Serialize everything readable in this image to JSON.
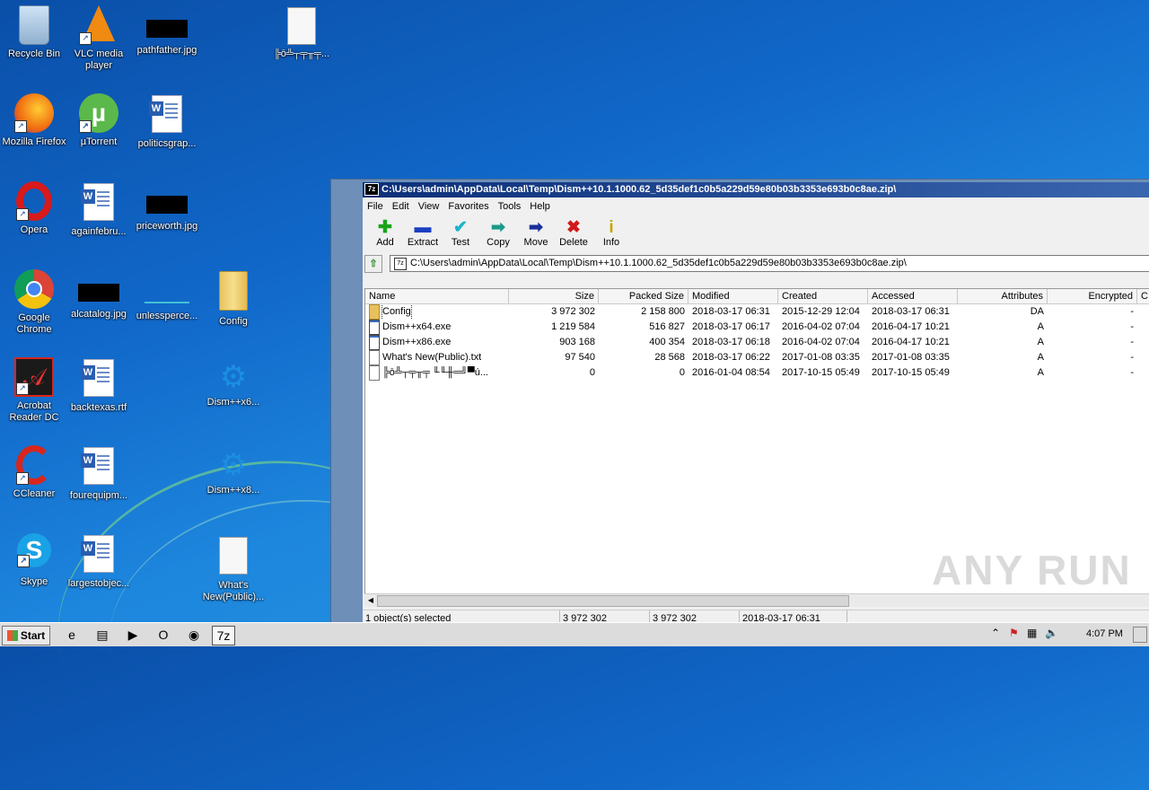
{
  "desktop": {
    "icons": [
      {
        "label": "Recycle Bin"
      },
      {
        "label": "VLC media player"
      },
      {
        "label": "pathfather.jpg"
      },
      {
        "label": "╠ō╩┬╤╥╤..."
      },
      {
        "label": "Mozilla Firefox"
      },
      {
        "label": "µTorrent"
      },
      {
        "label": "politicsgrap..."
      },
      {
        "label": "Opera"
      },
      {
        "label": "againfebru..."
      },
      {
        "label": "priceworth.jpg"
      },
      {
        "label": "Google Chrome"
      },
      {
        "label": "alcatalog.jpg"
      },
      {
        "label": "unlessperce..."
      },
      {
        "label": "Config"
      },
      {
        "label": "Acrobat Reader DC"
      },
      {
        "label": "backtexas.rtf"
      },
      {
        "label": "Dism++x6..."
      },
      {
        "label": "CCleaner"
      },
      {
        "label": "fourequipm..."
      },
      {
        "label": "Dism++x8..."
      },
      {
        "label": "Skype"
      },
      {
        "label": "largestobjec..."
      },
      {
        "label": "What's New(Public)..."
      }
    ]
  },
  "window": {
    "title": "C:\\Users\\admin\\AppData\\Local\\Temp\\Dism++10.1.1000.62_5d35def1c0b5a229d59e80b03b3353e693b0c8ae.zip\\",
    "title_icon": "7z",
    "menu": [
      "File",
      "Edit",
      "View",
      "Favorites",
      "Tools",
      "Help"
    ],
    "toolbar": [
      {
        "label": "Add",
        "icon": "plus-icon",
        "glyph": "✚",
        "color": "#1aa31a"
      },
      {
        "label": "Extract",
        "icon": "minus-icon",
        "glyph": "▬",
        "color": "#1b3fc2"
      },
      {
        "label": "Test",
        "icon": "check-icon",
        "glyph": "✔",
        "color": "#1bb5c8"
      },
      {
        "label": "Copy",
        "icon": "copy-arrow-icon",
        "glyph": "➡",
        "color": "#1a9a8a"
      },
      {
        "label": "Move",
        "icon": "move-arrow-icon",
        "glyph": "➡",
        "color": "#1a2f9a"
      },
      {
        "label": "Delete",
        "icon": "delete-x-icon",
        "glyph": "✖",
        "color": "#d01a1a"
      },
      {
        "label": "Info",
        "icon": "info-icon",
        "glyph": "i",
        "color": "#c8a400"
      }
    ],
    "address": "C:\\Users\\admin\\AppData\\Local\\Temp\\Dism++10.1.1000.62_5d35def1c0b5a229d59e80b03b3353e693b0c8ae.zip\\",
    "columns": [
      "Name",
      "Size",
      "Packed Size",
      "Modified",
      "Created",
      "Accessed",
      "Attributes",
      "Encrypted",
      "C"
    ],
    "rows": [
      {
        "type": "folder",
        "name": "Config",
        "size": "3 972 302",
        "packed": "2 158 800",
        "modified": "2018-03-17 06:31",
        "created": "2015-12-29 12:04",
        "accessed": "2018-03-17 06:31",
        "attributes": "DA",
        "encrypted": "-"
      },
      {
        "type": "exe",
        "name": "Dism++x64.exe",
        "size": "1 219 584",
        "packed": "516 827",
        "modified": "2018-03-17 06:17",
        "created": "2016-04-02 07:04",
        "accessed": "2016-04-17 10:21",
        "attributes": "A",
        "encrypted": "-"
      },
      {
        "type": "exe",
        "name": "Dism++x86.exe",
        "size": "903 168",
        "packed": "400 354",
        "modified": "2018-03-17 06:18",
        "created": "2016-04-02 07:04",
        "accessed": "2016-04-17 10:21",
        "attributes": "A",
        "encrypted": "-"
      },
      {
        "type": "txt",
        "name": "What's New(Public).txt",
        "size": "97 540",
        "packed": "28 568",
        "modified": "2018-03-17 06:22",
        "created": "2017-01-08 03:35",
        "accessed": "2017-01-08 03:35",
        "attributes": "A",
        "encrypted": "-"
      },
      {
        "type": "txt",
        "name": "╠ō╩┬╤╥╤ ╙╙╫═╝▀ú...",
        "size": "0",
        "packed": "0",
        "modified": "2016-01-04 08:54",
        "created": "2017-10-15 05:49",
        "accessed": "2017-10-15 05:49",
        "attributes": "A",
        "encrypted": "-"
      }
    ],
    "status": {
      "selected": "1 object(s) selected",
      "size": "3 972 302",
      "packed": "3 972 302",
      "modified": "2018-03-17 06:31"
    }
  },
  "watermark": "ANY RUN",
  "taskbar": {
    "start_label": "Start",
    "clock": "4:07 PM",
    "apps": [
      {
        "icon": "ie-icon",
        "glyph": "e"
      },
      {
        "icon": "explorer-icon",
        "glyph": "▤"
      },
      {
        "icon": "media-player-icon",
        "glyph": "▶"
      },
      {
        "icon": "opera-icon",
        "glyph": "O"
      },
      {
        "icon": "chrome-icon",
        "glyph": "◉"
      },
      {
        "icon": "sevenzip-icon",
        "glyph": "7z"
      }
    ]
  }
}
